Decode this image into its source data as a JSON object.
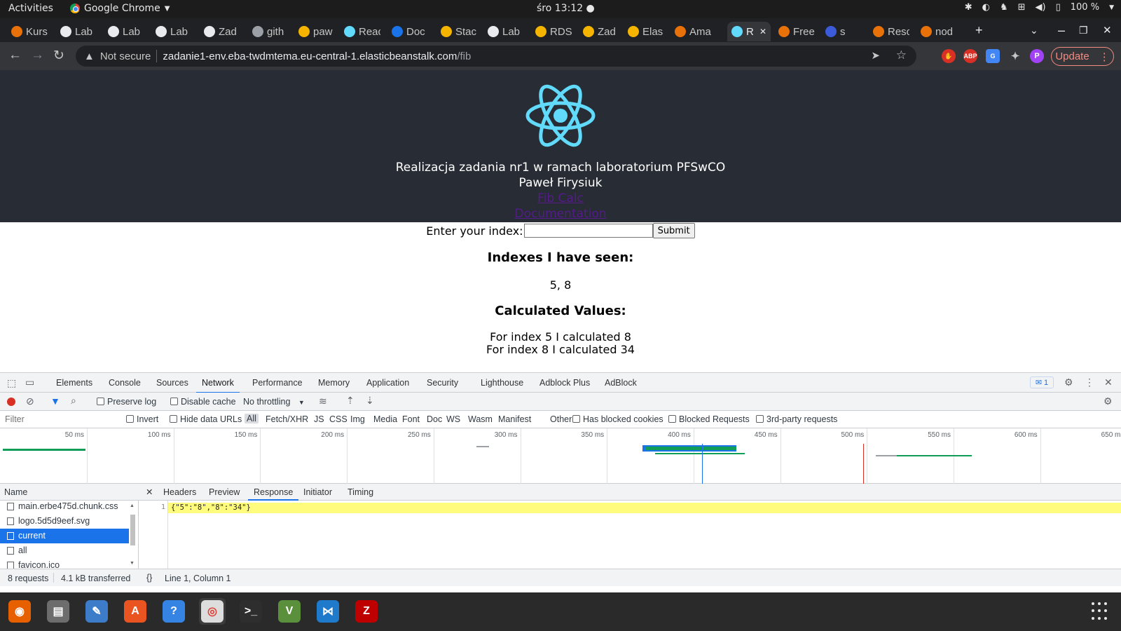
{
  "topbar": {
    "activities": "Activities",
    "app_name": "Google Chrome",
    "clock": "śro 13:12",
    "battery": "100 %"
  },
  "tabs": [
    {
      "label": "Kurs",
      "color": "#e8710a"
    },
    {
      "label": "Lab",
      "color": "#e8eaed"
    },
    {
      "label": "Lab",
      "color": "#e8eaed"
    },
    {
      "label": "Lab",
      "color": "#e8eaed"
    },
    {
      "label": "Zad",
      "color": "#e8eaed"
    },
    {
      "label": "gith",
      "color": "#9aa0a6"
    },
    {
      "label": "paw",
      "color": "#f4b400"
    },
    {
      "label": "Reac",
      "color": "#61dafb"
    },
    {
      "label": "Doc",
      "color": "#1a73e8"
    },
    {
      "label": "Stac",
      "color": "#f4b400"
    },
    {
      "label": "Lab",
      "color": "#e8eaed"
    },
    {
      "label": "RDS",
      "color": "#f4b400"
    },
    {
      "label": "Zad",
      "color": "#f4b400"
    },
    {
      "label": "Elas",
      "color": "#f4b400"
    },
    {
      "label": "Ama",
      "color": "#e8710a"
    },
    {
      "label": "R",
      "color": "#61dafb",
      "active": true
    },
    {
      "label": "Free",
      "color": "#e8710a"
    },
    {
      "label": "s",
      "color": "#3b5bdb"
    },
    {
      "label": "Reso",
      "color": "#e8710a"
    },
    {
      "label": "nod",
      "color": "#e8710a"
    }
  ],
  "toolbar": {
    "security_label": "Not secure",
    "url_host": "zadanie1-env.eba-twdmtema.eu-central-1.elasticbeanstalk.com",
    "url_path": "/fib",
    "update_label": "Update",
    "profile_initial": "P"
  },
  "page": {
    "title": "Realizacja zadania nr1 w ramach laboratorium PFSwCO",
    "author": "Paweł Firysiuk",
    "link_fib": "Fib Calc",
    "link_docs": "Documentation",
    "input_label": "Enter your index:",
    "input_value": "",
    "submit_label": "Submit",
    "seen_heading": "Indexes I have seen:",
    "seen_values": "5, 8",
    "calc_heading": "Calculated Values:",
    "calculated": [
      "For index 5 I calculated 8",
      "For index 8 I calculated 34"
    ]
  },
  "devtools": {
    "tabs": [
      "Elements",
      "Console",
      "Sources",
      "Network",
      "Performance",
      "Memory",
      "Application",
      "Security",
      "Lighthouse",
      "Adblock Plus",
      "AdBlock"
    ],
    "active_tab": "Network",
    "issues_count": "1",
    "preserve_log": "Preserve log",
    "disable_cache": "Disable cache",
    "throttling": "No throttling",
    "filter_placeholder": "Filter",
    "invert": "Invert",
    "hide_data_urls": "Hide data URLs",
    "filter_types": [
      "All",
      "Fetch/XHR",
      "JS",
      "CSS",
      "Img",
      "Media",
      "Font",
      "Doc",
      "WS",
      "Wasm",
      "Manifest",
      "Other"
    ],
    "has_blocked_cookies": "Has blocked cookies",
    "blocked_requests": "Blocked Requests",
    "third_party": "3rd-party requests",
    "timeline_ticks": [
      "50 ms",
      "100 ms",
      "150 ms",
      "200 ms",
      "250 ms",
      "300 ms",
      "350 ms",
      "400 ms",
      "450 ms",
      "500 ms",
      "550 ms",
      "600 ms",
      "650 ms"
    ],
    "name_header": "Name",
    "requests": [
      "main.erbe475d.chunk.css",
      "logo.5d5d9eef.svg",
      "current",
      "all",
      "favicon.ico"
    ],
    "selected_request": "current",
    "detail_tabs": [
      "Headers",
      "Preview",
      "Response",
      "Initiator",
      "Timing"
    ],
    "active_detail_tab": "Response",
    "response_line_no": "1",
    "response_body": "{\"5\":\"8\",\"8\":\"34\"}",
    "status_requests": "8 requests",
    "status_transferred": "4.1 kB transferred",
    "cursor_position": "Line 1, Column 1"
  },
  "dock": [
    "firefox-icon",
    "files-icon",
    "text-editor-icon",
    "software-icon",
    "help-icon",
    "chrome-icon",
    "terminal-icon",
    "vim-icon",
    "vscode-icon",
    "filezilla-icon"
  ]
}
